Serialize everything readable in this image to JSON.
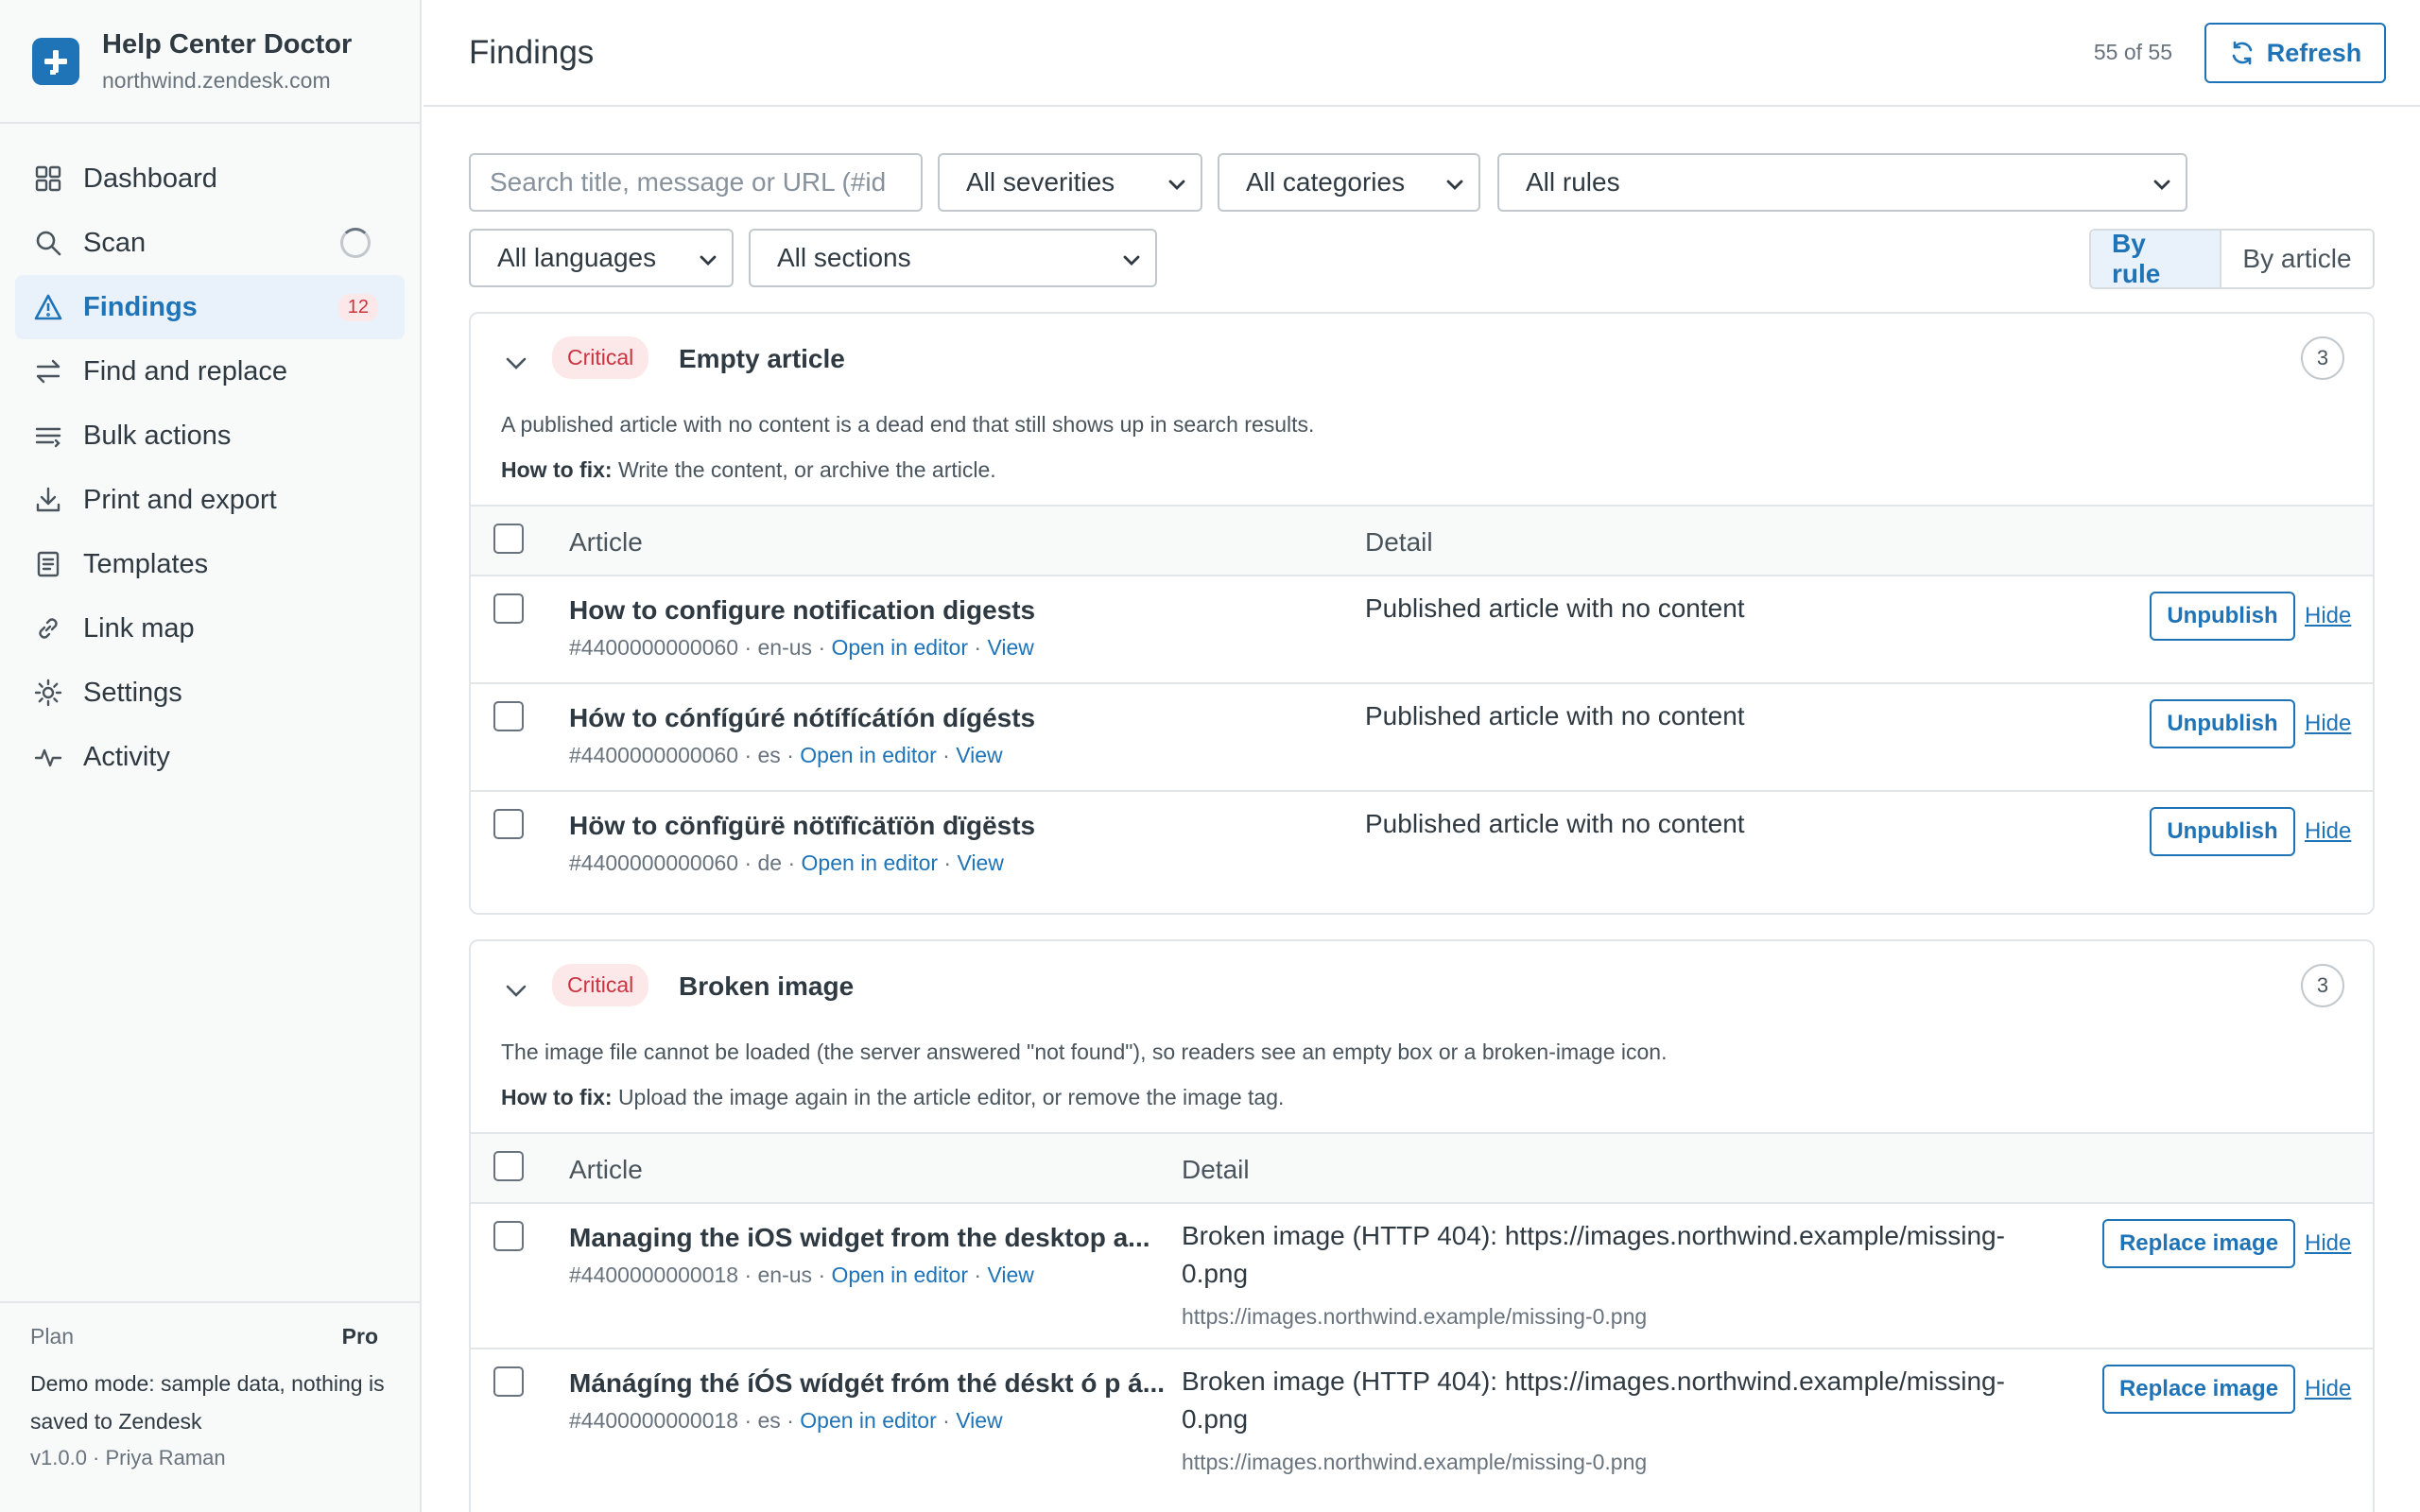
{
  "app": {
    "name": "Help Center Doctor",
    "domain": "northwind.zendesk.com"
  },
  "nav": [
    {
      "label": "Dashboard",
      "icon": "grid-icon"
    },
    {
      "label": "Scan",
      "icon": "search-icon"
    },
    {
      "label": "Findings",
      "icon": "warning-icon",
      "badge": "12"
    },
    {
      "label": "Find and replace",
      "icon": "swap-icon"
    },
    {
      "label": "Bulk actions",
      "icon": "list-icon"
    },
    {
      "label": "Print and export",
      "icon": "download-icon"
    },
    {
      "label": "Templates",
      "icon": "document-icon"
    },
    {
      "label": "Link map",
      "icon": "link-icon"
    },
    {
      "label": "Settings",
      "icon": "gear-icon"
    },
    {
      "label": "Activity",
      "icon": "activity-icon"
    }
  ],
  "footer": {
    "plan_label": "Plan",
    "plan_value": "Pro",
    "demo_text": "Demo mode: sample data, nothing is saved to Zendesk",
    "version": "v1.0.0 · Priya Raman"
  },
  "header": {
    "title": "Findings",
    "count": "55 of 55",
    "refresh_label": "Refresh"
  },
  "filters": {
    "search_placeholder": "Search title, message or URL (#id",
    "severity": "All severities",
    "category": "All categories",
    "rule": "All rules",
    "language": "All languages",
    "section": "All sections",
    "view_by_rule": "By rule",
    "view_by_article": "By article"
  },
  "table": {
    "col_article": "Article",
    "col_detail": "Detail",
    "open_editor": "Open in editor",
    "view": "View",
    "hide": "Hide"
  },
  "groups": [
    {
      "severity": "Critical",
      "title": "Empty article",
      "count": "3",
      "description": "A published article with no content is a dead end that still shows up in search results.",
      "fix_label": "How to fix:",
      "fix": "Write the content, or archive the article.",
      "action": "Unpublish",
      "rows": [
        {
          "title": "How to configure notification digests",
          "meta": "#4400000000060 · en-us · ",
          "detail": "Published article with no content"
        },
        {
          "title": "Hów to cónfígúré nótífícátíón dígésts",
          "meta": "#4400000000060 · es · ",
          "detail": "Published article with no content"
        },
        {
          "title": "Höw to cönfïgürë nötïfïcätïön dïgësts",
          "meta": "#4400000000060 · de · ",
          "detail": "Published article with no content"
        }
      ]
    },
    {
      "severity": "Critical",
      "title": "Broken image",
      "count": "3",
      "description": "The image file cannot be loaded (the server answered \"not found\"), so readers see an empty box or a broken-image icon.",
      "fix_label": "How to fix:",
      "fix": "Upload the image again in the article editor, or remove the image tag.",
      "action": "Replace image",
      "rows": [
        {
          "title": "Managing the iOS widget from the desktop a...",
          "meta": "#4400000000018 · en-us · ",
          "detail": "Broken image (HTTP 404): https://images.northwind.example/missing-0.png",
          "sub": "https://images.northwind.example/missing-0.png"
        },
        {
          "title": "Mánágíng thé íÓS wídgét fróm thé déskt ó p á...",
          "meta": "#4400000000018 · es · ",
          "detail": "Broken image (HTTP 404): https://images.northwind.example/missing-0.png",
          "sub": "https://images.northwind.example/missing-0.png"
        }
      ]
    }
  ]
}
